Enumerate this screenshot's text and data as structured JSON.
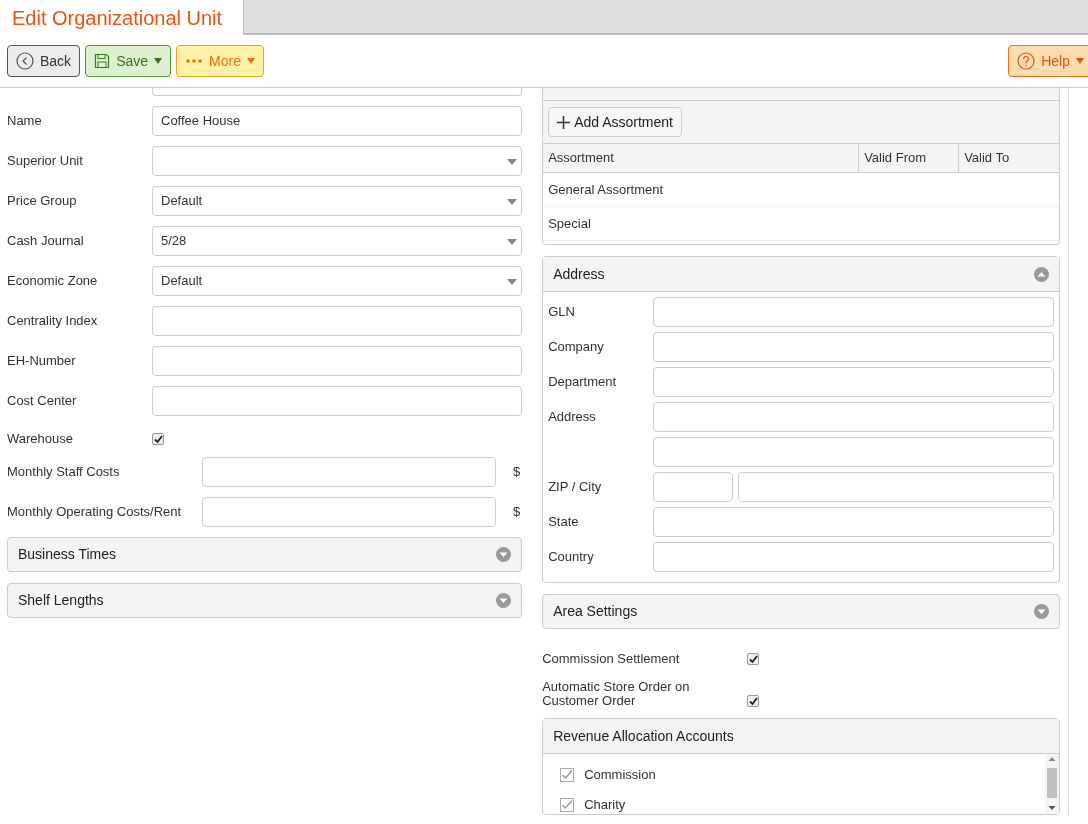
{
  "tab": {
    "title": "Edit Organizational Unit"
  },
  "toolbar": [
    {
      "kind": "back",
      "label": "Back",
      "menu": false
    },
    {
      "kind": "save",
      "label": "Save",
      "menu": true
    },
    {
      "kind": "more",
      "label": "More",
      "menu": true
    },
    {
      "kind": "help",
      "label": "Help",
      "menu": true
    }
  ],
  "general_fields": [
    {
      "kind": "text",
      "label": "Name",
      "value": "Coffee House"
    },
    {
      "kind": "select",
      "label": "Superior Unit"
    },
    {
      "kind": "select",
      "label": "Price Group",
      "value": "Default"
    },
    {
      "kind": "select",
      "label": "Cash Journal",
      "value": "5/28"
    },
    {
      "kind": "select",
      "label": "Economic Zone",
      "value": "Default"
    },
    {
      "kind": "text",
      "label": "Centrality Index"
    },
    {
      "kind": "text",
      "label": "EH-Number"
    },
    {
      "kind": "text",
      "label": "Cost Center"
    },
    {
      "kind": "checkbox",
      "label": "Warehouse",
      "checked": true
    },
    {
      "kind": "currency",
      "label": "Monthly Staff Costs",
      "unit": "$"
    },
    {
      "kind": "currency",
      "label": "Monthly Operating Costs/Rent",
      "unit": "$"
    }
  ],
  "left_panels": [
    {
      "title": "Business Times",
      "expanded": false
    },
    {
      "title": "Shelf Lengths",
      "expanded": false
    }
  ],
  "assortments": {
    "add_button": "Add Assortment",
    "columns": [
      "Assortment",
      "Valid From",
      "Valid To"
    ],
    "rows": [
      [
        "General Assortment"
      ],
      [
        "Special"
      ]
    ]
  },
  "address": {
    "title": "Address",
    "expanded": true,
    "fields": [
      {
        "label": "GLN",
        "kind": "single"
      },
      {
        "label": "Company",
        "kind": "single"
      },
      {
        "label": "Department",
        "kind": "single"
      },
      {
        "label": "Address",
        "kind": "single"
      },
      {
        "kind": "single"
      },
      {
        "label": "ZIP / City",
        "kind": "split"
      },
      {
        "label": "State",
        "kind": "single"
      },
      {
        "label": "Country",
        "kind": "single"
      }
    ]
  },
  "area_settings": {
    "title": "Area Settings",
    "expanded": false
  },
  "options": [
    {
      "label": "Commission Settlement",
      "checked": true
    },
    {
      "label": "Automatic Store Order on Customer Order",
      "checked": true
    }
  ],
  "revenue_accounts": {
    "title": "Revenue Allocation Accounts",
    "items": [
      {
        "label": "Commission",
        "checked": true
      },
      {
        "label": "Charity",
        "checked": true
      }
    ]
  }
}
